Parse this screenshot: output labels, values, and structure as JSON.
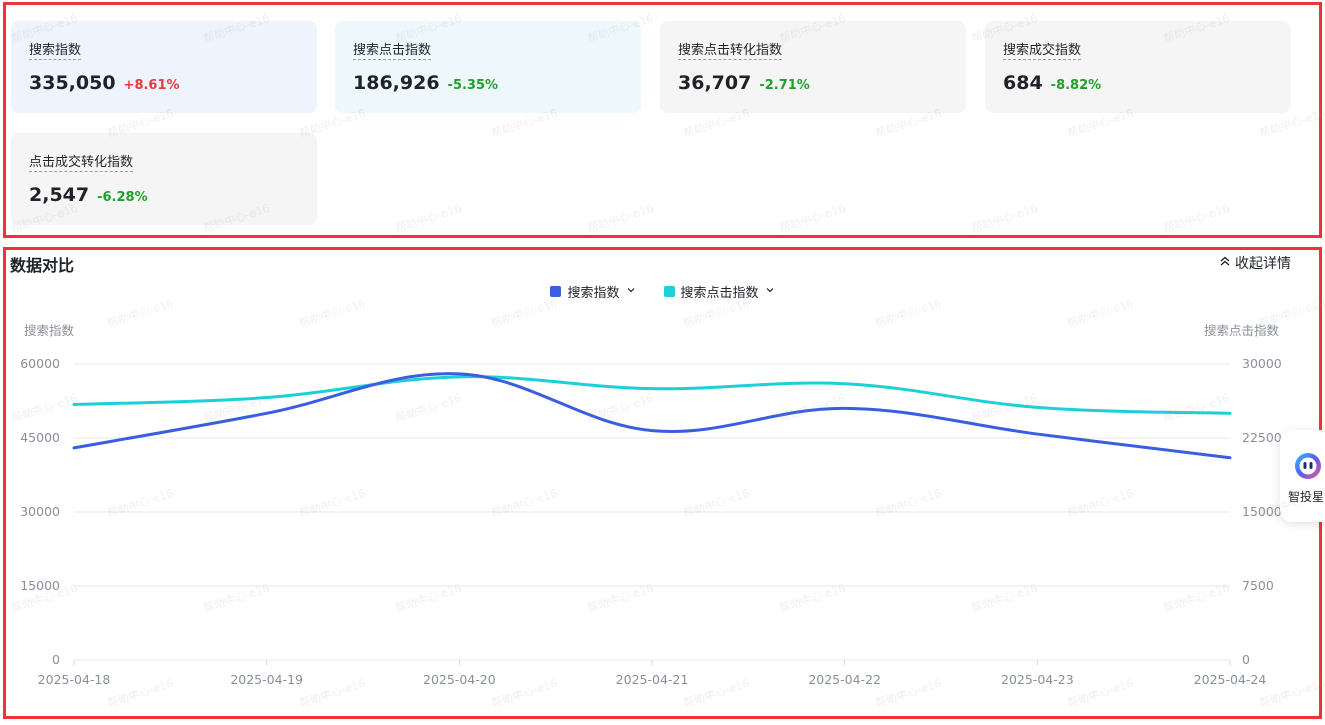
{
  "metrics": [
    {
      "label": "搜索指数",
      "value": "335,050",
      "delta": "+8.61%",
      "trend": "up",
      "bg": "#eef3fe"
    },
    {
      "label": "搜索点击指数",
      "value": "186,926",
      "delta": "-5.35%",
      "trend": "down",
      "bg": "#eef8fc"
    },
    {
      "label": "搜索点击转化指数",
      "value": "36,707",
      "delta": "-2.71%",
      "trend": "down",
      "bg": "#f5f5f6"
    },
    {
      "label": "搜索成交指数",
      "value": "684",
      "delta": "-8.82%",
      "trend": "down",
      "bg": "#f5f5f6"
    },
    {
      "label": "点击成交转化指数",
      "value": "2,547",
      "delta": "-6.28%",
      "trend": "down",
      "bg": "#f5f5f6"
    }
  ],
  "section": {
    "title": "数据对比",
    "collapse_label": "收起详情"
  },
  "legend": [
    {
      "label": "搜索指数",
      "color": "#3a5ee0"
    },
    {
      "label": "搜索点击指数",
      "color": "#1ccfd9"
    }
  ],
  "assistant": {
    "label": "智投星"
  },
  "watermark": "帮助中心-e16",
  "chart_data": {
    "type": "line",
    "x": [
      "2025-04-18",
      "2025-04-19",
      "2025-04-20",
      "2025-04-21",
      "2025-04-22",
      "2025-04-23",
      "2025-04-24"
    ],
    "ylabel": "搜索指数",
    "ylabel_right": "搜索点击指数",
    "yticks": [
      "0",
      "15000",
      "30000",
      "45000",
      "60000"
    ],
    "yticks_right": [
      "0",
      "7500",
      "15000",
      "22500",
      "30000"
    ],
    "ylim": [
      0,
      60000
    ],
    "ylim_right": [
      0,
      30000
    ],
    "series": [
      {
        "name": "搜索指数",
        "axis": "left",
        "color": "#3a5ee0",
        "values": [
          43000,
          50000,
          58000,
          46500,
          51000,
          45800,
          41000
        ]
      },
      {
        "name": "搜索点击指数",
        "axis": "right",
        "color": "#1ccfd9",
        "values": [
          25900,
          26600,
          28700,
          27500,
          28000,
          25600,
          25000
        ]
      }
    ],
    "grid": true,
    "legend_position": "top-center"
  }
}
